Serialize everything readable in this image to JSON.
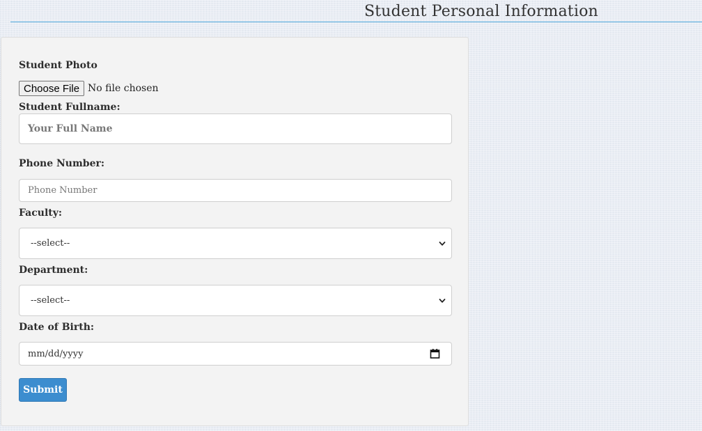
{
  "page": {
    "title": "Student Personal Information"
  },
  "form": {
    "photo": {
      "label": "Student Photo",
      "button_label": "Choose File",
      "status": "No file chosen"
    },
    "fullname": {
      "label": "Student Fullname:",
      "placeholder": "Your Full Name"
    },
    "phone": {
      "label": "Phone Number:",
      "placeholder": "Phone Number"
    },
    "faculty": {
      "label": "Faculty:",
      "selected": "--select--"
    },
    "department": {
      "label": "Department:",
      "selected": "--select--"
    },
    "dob": {
      "label": "Date of Birth:",
      "placeholder": "mm/dd/yyyy"
    },
    "submit_label": "Submit"
  },
  "colors": {
    "accent": "#3c8dcf",
    "title_rule": "#4aa3d8",
    "panel_bg": "#f3f3f3"
  },
  "icons": {
    "select_arrow": "chevron-down-icon",
    "date_picker": "calendar-icon"
  }
}
